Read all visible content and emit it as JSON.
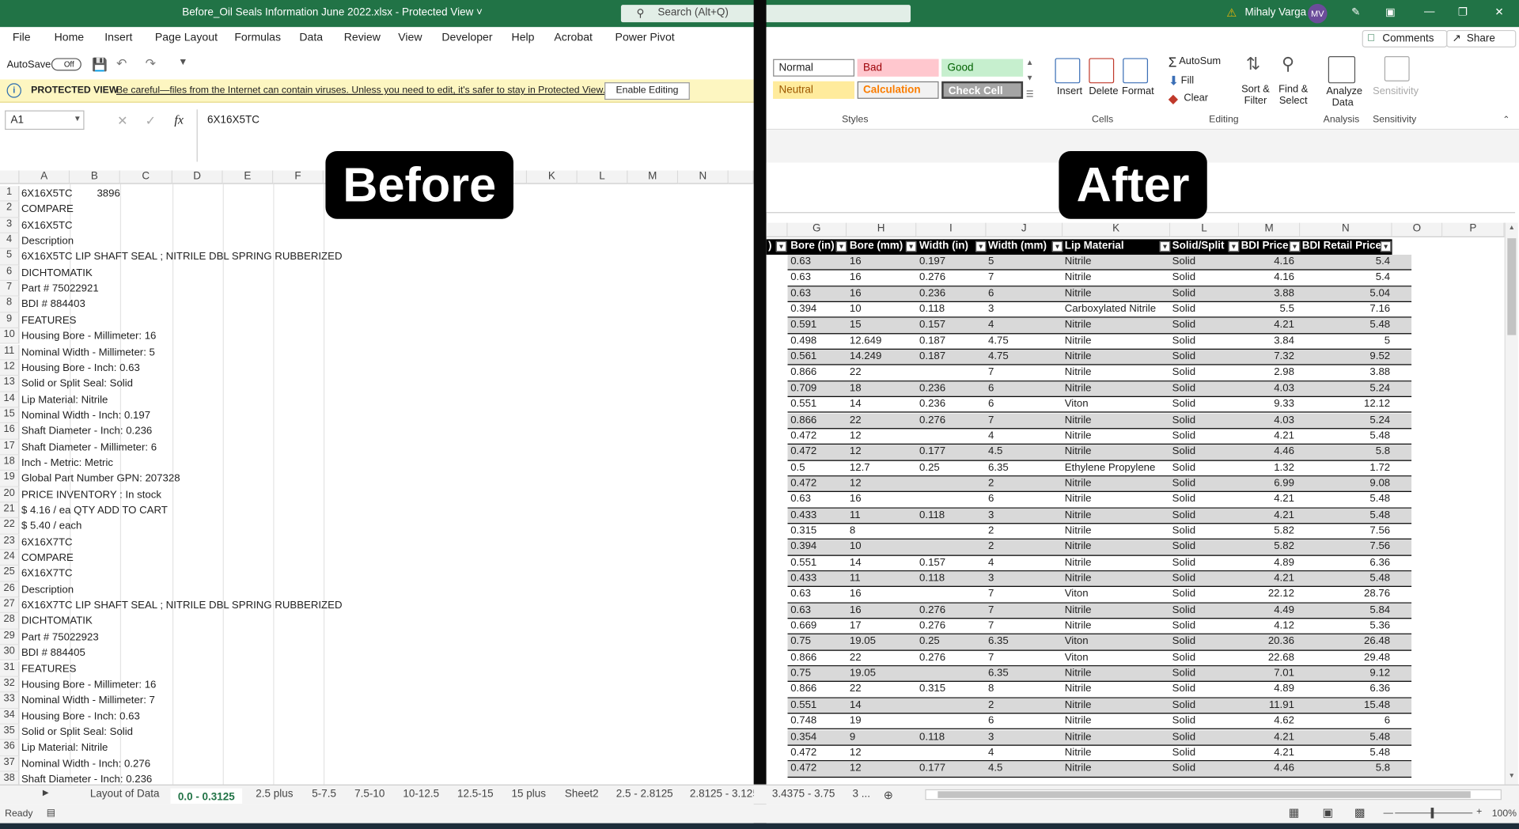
{
  "titlebar": {
    "title": "Before_Oil Seals Information June 2022.xlsx  -  Protected View ˅",
    "search_placeholder": "Search (Alt+Q)",
    "user": "Mihaly Varga",
    "initials": "MV"
  },
  "menu": [
    "File",
    "Home",
    "Insert",
    "Page Layout",
    "Formulas",
    "Data",
    "Review",
    "View",
    "Developer",
    "Help",
    "Acrobat",
    "Power Pivot"
  ],
  "qat": {
    "autosave": "AutoSave",
    "toggle": "Off"
  },
  "protected": {
    "label": "PROTECTED VIEW",
    "message": "Be careful—files from the Internet can contain viruses. Unless you need to edit, it's safer to stay in Protected View.",
    "button": "Enable Editing"
  },
  "formula": {
    "namebox": "A1",
    "fx": "fx",
    "value": "6X16X5TC"
  },
  "ribbon": {
    "comments": "Comments",
    "share": "Share",
    "styles": [
      "Normal",
      "Bad",
      "Good",
      "Neutral",
      "Calculation",
      "Check Cell"
    ],
    "cells": [
      "Insert",
      "Delete",
      "Format"
    ],
    "editing": [
      "AutoSum",
      "Fill",
      "Clear",
      "Sort & Filter",
      "Find & Select"
    ],
    "analysis": "Analyze Data",
    "sensitivity": "Sensitivity",
    "groups": [
      "Styles",
      "Cells",
      "Editing",
      "Analysis",
      "Sensitivity"
    ]
  },
  "overlays": {
    "before": "Before",
    "after": "After"
  },
  "left": {
    "columns": [
      "A",
      "B",
      "C",
      "D",
      "E",
      "F",
      "K",
      "L",
      "M",
      "N"
    ],
    "rows": [
      [
        "6X16X5TC",
        "3896"
      ],
      [
        " COMPARE",
        ""
      ],
      [
        "6X16X5TC",
        ""
      ],
      [
        "Description",
        ""
      ],
      [
        "6X16X5TC LIP SHAFT SEAL ; NITRILE DBL SPRING RUBBERIZED",
        ""
      ],
      [
        "DICHTOMATIK",
        ""
      ],
      [
        "Part # 75022921",
        ""
      ],
      [
        "BDI # 884403",
        ""
      ],
      [
        "FEATURES",
        ""
      ],
      [
        "Housing Bore - Millimeter: 16",
        ""
      ],
      [
        "Nominal Width - Millimeter: 5",
        ""
      ],
      [
        "Housing Bore - Inch: 0.63",
        ""
      ],
      [
        "Solid or Split Seal: Solid",
        ""
      ],
      [
        "Lip Material: Nitrile",
        ""
      ],
      [
        "Nominal Width - Inch: 0.197",
        ""
      ],
      [
        "Shaft Diameter - Inch: 0.236",
        ""
      ],
      [
        "Shaft Diameter - Millimeter: 6",
        ""
      ],
      [
        "Inch - Metric: Metric",
        ""
      ],
      [
        "Global Part Number GPN: 207328",
        ""
      ],
      [
        "PRICE        INVENTORY : In stock",
        ""
      ],
      [
        "$ 4.16 / ea QTY          ADD TO CART",
        ""
      ],
      [
        "$ 5.40 / each",
        ""
      ],
      [
        "6X16X7TC",
        ""
      ],
      [
        " COMPARE",
        ""
      ],
      [
        "6X16X7TC",
        ""
      ],
      [
        "Description",
        ""
      ],
      [
        "6X16X7TC LIP SHAFT SEAL ; NITRILE DBL SPRING RUBBERIZED",
        ""
      ],
      [
        "DICHTOMATIK",
        ""
      ],
      [
        "Part # 75022923",
        ""
      ],
      [
        "BDI # 884405",
        ""
      ],
      [
        "FEATURES",
        ""
      ],
      [
        "Housing Bore - Millimeter: 16",
        ""
      ],
      [
        "Nominal Width - Millimeter: 7",
        ""
      ],
      [
        "Housing Bore - Inch: 0.63",
        ""
      ],
      [
        "Solid or Split Seal: Solid",
        ""
      ],
      [
        "Lip Material: Nitrile",
        ""
      ],
      [
        "Nominal Width - Inch: 0.276",
        ""
      ],
      [
        "Shaft Diameter - Inch: 0.236",
        ""
      ]
    ]
  },
  "right": {
    "columns": [
      "G",
      "H",
      "I",
      "J",
      "K",
      "L",
      "M",
      "N",
      "O",
      "P"
    ],
    "headers": [
      ")",
      "Bore (in)",
      "Bore (mm)",
      "Width (in)",
      "Width (mm)",
      "Lip Material",
      "Solid/Split",
      "BDI Price",
      "BDI Retail Price"
    ],
    "rows": [
      [
        "0.63",
        "16",
        "0.197",
        "5",
        "Nitrile",
        "Solid",
        "4.16",
        "5.4"
      ],
      [
        "0.63",
        "16",
        "0.276",
        "7",
        "Nitrile",
        "Solid",
        "4.16",
        "5.4"
      ],
      [
        "0.63",
        "16",
        "0.236",
        "6",
        "Nitrile",
        "Solid",
        "3.88",
        "5.04"
      ],
      [
        "0.394",
        "10",
        "0.118",
        "3",
        "Carboxylated Nitrile",
        "Solid",
        "5.5",
        "7.16"
      ],
      [
        "0.591",
        "15",
        "0.157",
        "4",
        "Nitrile",
        "Solid",
        "4.21",
        "5.48"
      ],
      [
        "0.498",
        "12.649",
        "0.187",
        "4.75",
        "Nitrile",
        "Solid",
        "3.84",
        "5"
      ],
      [
        "0.561",
        "14.249",
        "0.187",
        "4.75",
        "Nitrile",
        "Solid",
        "7.32",
        "9.52"
      ],
      [
        "0.866",
        "22",
        "",
        "7",
        "Nitrile",
        "Solid",
        "2.98",
        "3.88"
      ],
      [
        "0.709",
        "18",
        "0.236",
        "6",
        "Nitrile",
        "Solid",
        "4.03",
        "5.24"
      ],
      [
        "0.551",
        "14",
        "0.236",
        "6",
        "Viton",
        "Solid",
        "9.33",
        "12.12"
      ],
      [
        "0.866",
        "22",
        "0.276",
        "7",
        "Nitrile",
        "Solid",
        "4.03",
        "5.24"
      ],
      [
        "0.472",
        "12",
        "",
        "4",
        "Nitrile",
        "Solid",
        "4.21",
        "5.48"
      ],
      [
        "0.472",
        "12",
        "0.177",
        "4.5",
        "Nitrile",
        "Solid",
        "4.46",
        "5.8"
      ],
      [
        "0.5",
        "12.7",
        "0.25",
        "6.35",
        "Ethylene Propylene",
        "Solid",
        "1.32",
        "1.72"
      ],
      [
        "0.472",
        "12",
        "",
        "2",
        "Nitrile",
        "Solid",
        "6.99",
        "9.08"
      ],
      [
        "0.63",
        "16",
        "",
        "6",
        "Nitrile",
        "Solid",
        "4.21",
        "5.48"
      ],
      [
        "0.433",
        "11",
        "0.118",
        "3",
        "Nitrile",
        "Solid",
        "4.21",
        "5.48"
      ],
      [
        "0.315",
        "8",
        "",
        "2",
        "Nitrile",
        "Solid",
        "5.82",
        "7.56"
      ],
      [
        "0.394",
        "10",
        "",
        "2",
        "Nitrile",
        "Solid",
        "5.82",
        "7.56"
      ],
      [
        "0.551",
        "14",
        "0.157",
        "4",
        "Nitrile",
        "Solid",
        "4.89",
        "6.36"
      ],
      [
        "0.433",
        "11",
        "0.118",
        "3",
        "Nitrile",
        "Solid",
        "4.21",
        "5.48"
      ],
      [
        "0.63",
        "16",
        "",
        "7",
        "Viton",
        "Solid",
        "22.12",
        "28.76"
      ],
      [
        "0.63",
        "16",
        "0.276",
        "7",
        "Nitrile",
        "Solid",
        "4.49",
        "5.84"
      ],
      [
        "0.669",
        "17",
        "0.276",
        "7",
        "Nitrile",
        "Solid",
        "4.12",
        "5.36"
      ],
      [
        "0.75",
        "19.05",
        "0.25",
        "6.35",
        "Viton",
        "Solid",
        "20.36",
        "26.48"
      ],
      [
        "0.866",
        "22",
        "0.276",
        "7",
        "Viton",
        "Solid",
        "22.68",
        "29.48"
      ],
      [
        "0.75",
        "19.05",
        "",
        "6.35",
        "Nitrile",
        "Solid",
        "7.01",
        "9.12"
      ],
      [
        "0.866",
        "22",
        "0.315",
        "8",
        "Nitrile",
        "Solid",
        "4.89",
        "6.36"
      ],
      [
        "0.551",
        "14",
        "",
        "2",
        "Nitrile",
        "Solid",
        "11.91",
        "15.48"
      ],
      [
        "0.748",
        "19",
        "",
        "6",
        "Nitrile",
        "Solid",
        "4.62",
        "6"
      ],
      [
        "0.354",
        "9",
        "0.118",
        "3",
        "Nitrile",
        "Solid",
        "4.21",
        "5.48"
      ],
      [
        "0.472",
        "12",
        "",
        "4",
        "Nitrile",
        "Solid",
        "4.21",
        "5.48"
      ],
      [
        "0.472",
        "12",
        "0.177",
        "4.5",
        "Nitrile",
        "Solid",
        "4.46",
        "5.8"
      ]
    ]
  },
  "tabs": [
    "Layout of Data",
    "0.0 - 0.3125",
    "2.5 plus",
    "5-7.5",
    "7.5-10",
    "10-12.5",
    "12.5-15",
    "15 plus",
    "Sheet2",
    "2.5 - 2.8125",
    "2.8125 - 3.125",
    "3.4375 - 3.75",
    "3 ..."
  ],
  "status": {
    "ready": "Ready",
    "zoom": "100%"
  }
}
